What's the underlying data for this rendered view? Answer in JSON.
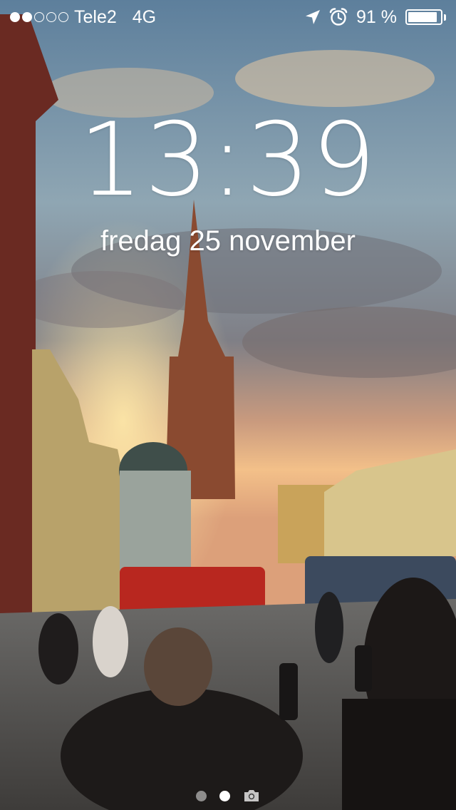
{
  "status_bar": {
    "signal_strength": 2,
    "signal_max": 5,
    "carrier": "Tele2",
    "network": "4G",
    "battery_text": "91 %",
    "battery_level": 0.91,
    "icons": [
      "location-arrow-icon",
      "alarm-clock-icon",
      "battery-icon"
    ]
  },
  "lock_screen": {
    "time": "13:39",
    "date": "fredag 25 november"
  },
  "page_indicator": {
    "count": 2,
    "active_index": 1,
    "camera_icon": "camera-icon"
  }
}
